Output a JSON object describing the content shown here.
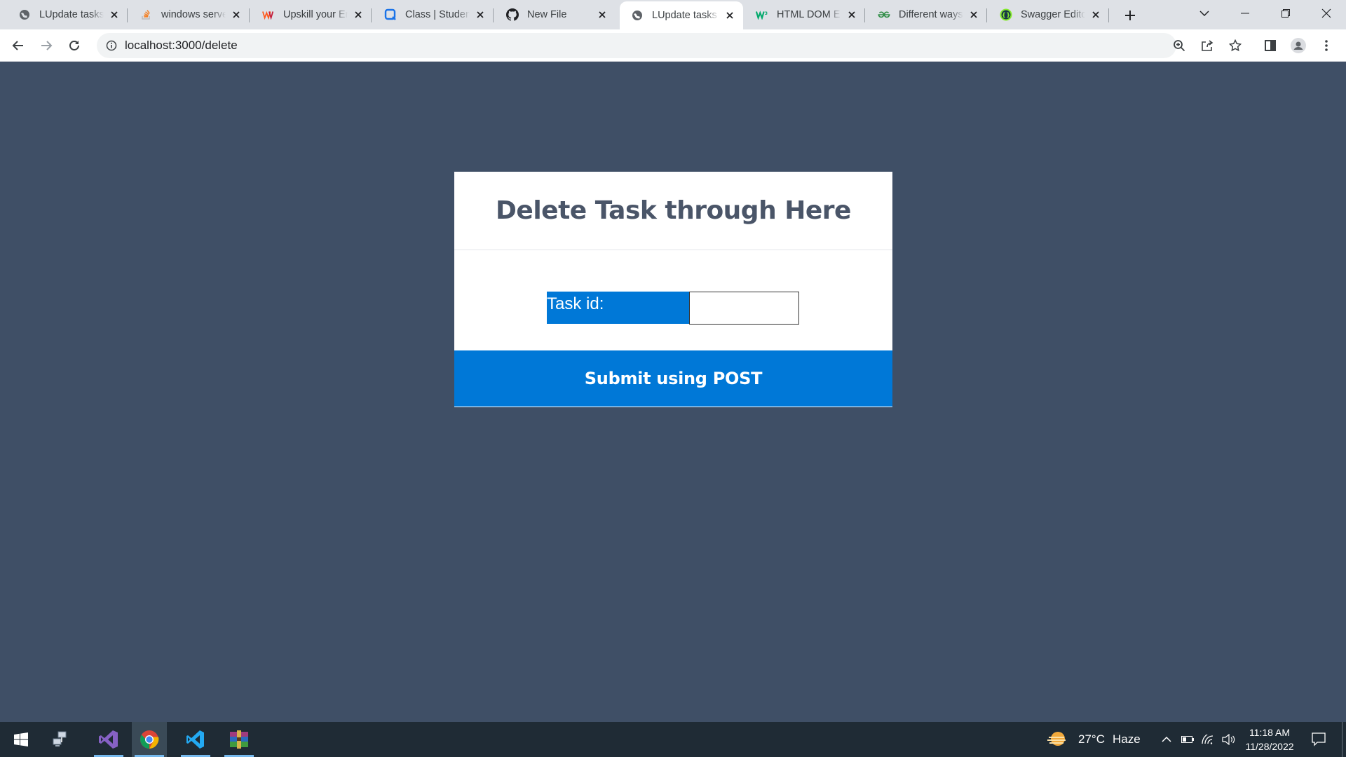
{
  "browser": {
    "tabs": [
      {
        "title": "LUpdate tasks",
        "icon": "globe-icon"
      },
      {
        "title": "windows serve",
        "icon": "stackoverflow-icon"
      },
      {
        "title": "Upskill your Er",
        "icon": "upskill-logo-icon"
      },
      {
        "title": "Class | Student",
        "icon": "classroom-icon"
      },
      {
        "title": "New File",
        "icon": "github-icon"
      },
      {
        "title": "LUpdate tasks",
        "icon": "globe-icon",
        "active": true
      },
      {
        "title": "HTML DOM El",
        "icon": "w3schools-icon"
      },
      {
        "title": "Different ways",
        "icon": "geeksforgeeks-icon"
      },
      {
        "title": "Swagger Editor",
        "icon": "swagger-icon"
      }
    ],
    "address": "localhost:3000/delete"
  },
  "page": {
    "heading": "Delete Task through Here",
    "task_label": "Task id:",
    "task_value": "",
    "submit_label": "Submit using POST"
  },
  "taskbar": {
    "weather": {
      "temp": "27°C",
      "condition": "Haze"
    },
    "time": "11:18 AM",
    "date": "11/28/2022"
  },
  "colors": {
    "page_bg": "#3f4f66",
    "accent": "#0078d7",
    "heading": "#4a5568"
  }
}
